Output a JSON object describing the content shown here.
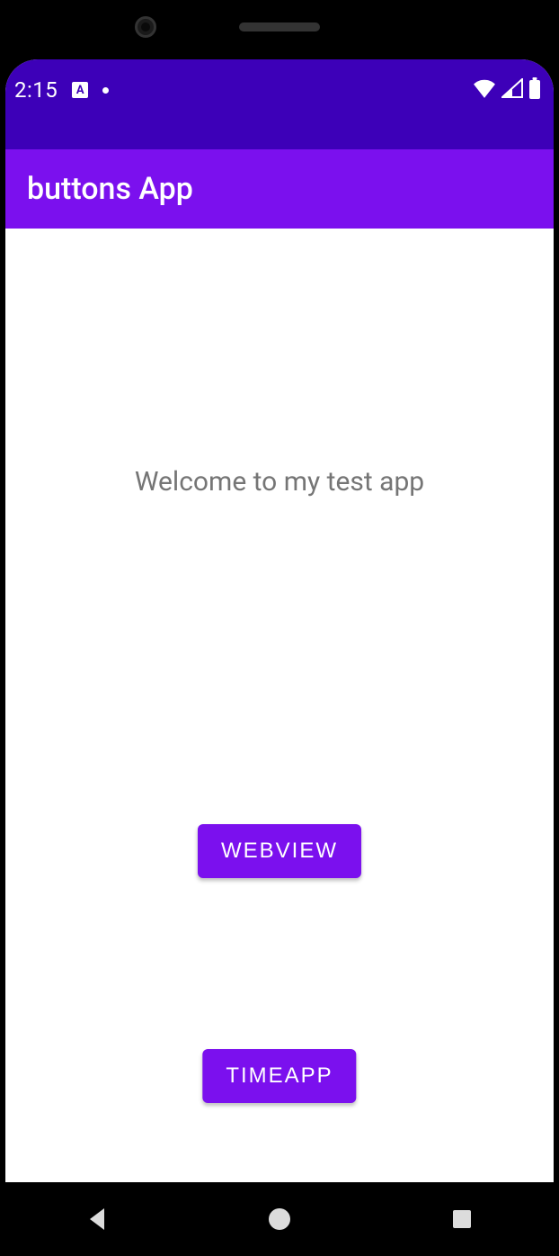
{
  "statusbar": {
    "time": "2:15",
    "icon_label": "A"
  },
  "appbar": {
    "title": "buttons App"
  },
  "main": {
    "welcome_text": "Welcome to my test app",
    "webview_button": "WEBVIEW",
    "timeapp_button": "TIMEAPP"
  }
}
